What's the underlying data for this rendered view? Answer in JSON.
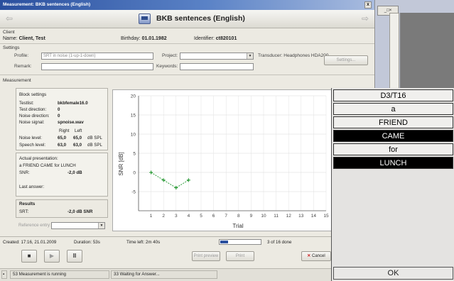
{
  "window": {
    "title": "Measurement: BKB sentences (English)",
    "close": "x"
  },
  "header": {
    "title": "BKB sentences (English)"
  },
  "client": {
    "section": "Client",
    "name_label": "Name:",
    "name": "Client, Test",
    "birthday_label": "Birthday:",
    "birthday": "01.01.1982",
    "identifier_label": "Identifier:",
    "identifier": "ct820101"
  },
  "settings": {
    "section": "Settings",
    "profile_label": "Profile:",
    "profile_value": "SRT in noise (1-up-1-down)",
    "project_label": "Project:",
    "transducer": "Transducer: Headphones HDA200",
    "remark_label": "Remark:",
    "keywords_label": "Keywords:",
    "settings_button": "Settings..."
  },
  "measurement": {
    "section": "Measurement",
    "block_settings": "Block settings",
    "testlist_label": "Testlist:",
    "testlist": "bkbfemale16.0",
    "test_direction_label": "Test direction:",
    "test_direction": "0",
    "noise_direction_label": "Noise direction:",
    "noise_direction": "0",
    "noise_signal_label": "Noise signal:",
    "noise_signal": "spnoise.wav",
    "right_label": "Right",
    "left_label": "Left",
    "noise_level_label": "Noise level:",
    "noise_right": "65,0",
    "noise_left": "65,0",
    "noise_unit": "dB SPL",
    "speech_level_label": "Speech level:",
    "speech_right": "63,0",
    "speech_left": "63,0",
    "speech_unit": "dB SPL",
    "actual_label": "Actual presentation:",
    "actual_sentence": "a FRIEND CAME for LUNCH",
    "snr_label": "SNR:",
    "snr": "-2,0 dB",
    "last_answer_label": "Last answer:",
    "results_label": "Results",
    "srt_label": "SRT:",
    "srt": "-2,0 dB SNR",
    "reference_label": "Reference entry:"
  },
  "chart_data": {
    "type": "line",
    "xlabel": "Trial",
    "ylabel": "SNR [dB]",
    "xlim": [
      0,
      15
    ],
    "ylim": [
      -10,
      20
    ],
    "xticks": [
      "1",
      "2",
      "3",
      "4",
      "5",
      "6",
      "7",
      "8",
      "9",
      "10",
      "11",
      "12",
      "13",
      "14",
      "15"
    ],
    "yticks": [
      "-5",
      "0",
      "5",
      "10",
      "15",
      "20"
    ],
    "series": [
      {
        "x": [
          1,
          2,
          3,
          4
        ],
        "y": [
          0,
          -2,
          -4,
          -2
        ]
      }
    ],
    "color": "#2e9c3a"
  },
  "status": {
    "created": "Created: 17:16, 21.01.2009",
    "duration": "Duration: 53s",
    "time_left": "Time left: 2m 40s",
    "progress_fraction": 0.19,
    "done": "3 of 16 done",
    "running": "53 Measurement is running",
    "waiting": "33 Waiting for Answer..."
  },
  "controls": {
    "stop": "■",
    "play": "▶",
    "pause": "II",
    "print_preview": "Print preview",
    "print": "Print",
    "cancel": "Cancel"
  },
  "response": {
    "title": "D3/T16",
    "words": [
      {
        "text": "a",
        "selected": false
      },
      {
        "text": "FRIEND",
        "selected": false
      },
      {
        "text": "CAME",
        "selected": true
      },
      {
        "text": "for",
        "selected": false
      },
      {
        "text": "LUNCH",
        "selected": true
      }
    ],
    "ok": "OK"
  },
  "mini_window": {
    "controls": "_□×"
  }
}
